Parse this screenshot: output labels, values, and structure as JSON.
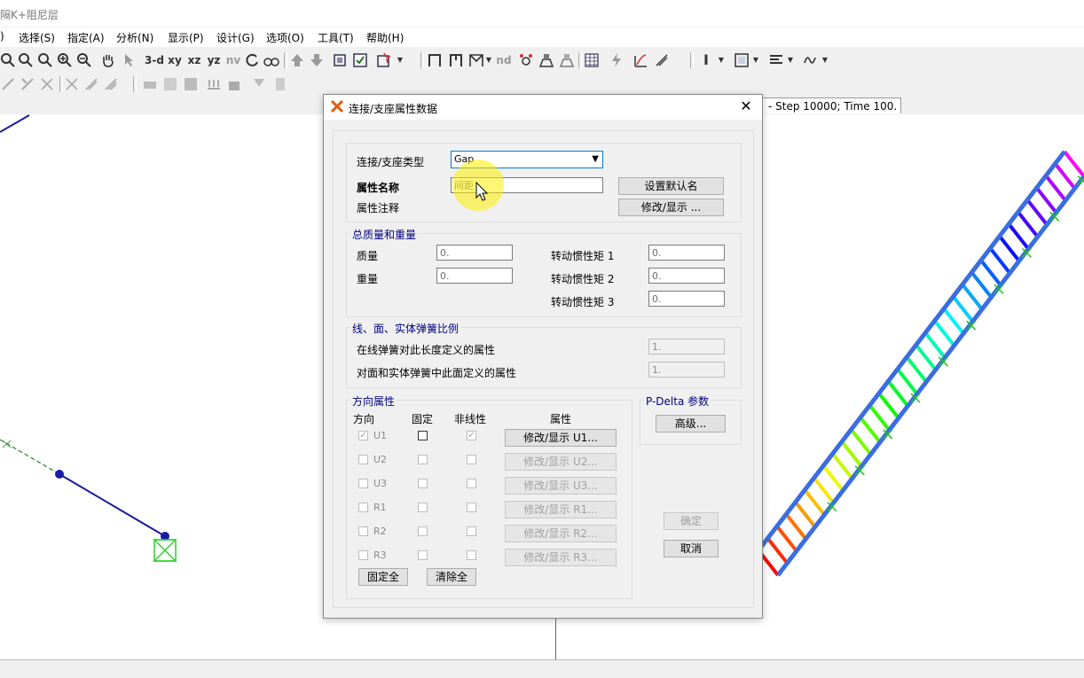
{
  "window": {
    "title": "隔K+阻尼层"
  },
  "menu": [
    "选择(S)",
    "指定(A)",
    "分析(N)",
    "显示(P)",
    "设计(G)",
    "选项(O)",
    "工具(T)",
    "帮助(H)"
  ],
  "toolbar": {
    "view_3d": "3-d",
    "view_xy": "xy",
    "view_xz": "xz",
    "view_yz": "yz",
    "view_nv": "nv",
    "nd": "nd"
  },
  "viewport": {
    "right_tab": "- Step 10000; Time 100."
  },
  "dialog": {
    "title": "连接/支座属性数据",
    "type_label": "连接/支座类型",
    "type_value": "Gap",
    "prop_name_label": "属性名称",
    "prop_name_value": "间距",
    "prop_note_label": "属性注释",
    "set_default_btn": "设置默认名",
    "modify_show_btn": "修改/显示 ...",
    "mass_group": {
      "title": "总质量和重量",
      "mass_label": "质量",
      "mass_value": "0.",
      "weight_label": "重量",
      "weight_value": "0.",
      "rot1_label": "转动惯性矩 1",
      "rot1_value": "0.",
      "rot2_label": "转动惯性矩 2",
      "rot2_value": "0.",
      "rot3_label": "转动惯性矩 3",
      "rot3_value": "0."
    },
    "spring_group": {
      "title": "线、面、实体弹簧比例",
      "line_label": "在线弹簧对此长度定义的属性",
      "line_value": "1.",
      "area_label": "对面和实体弹簧中此面定义的属性",
      "area_value": "1."
    },
    "direction_group": {
      "title": "方向属性",
      "col_direction": "方向",
      "col_fixed": "固定",
      "col_nonlinear": "非线性",
      "col_props": "属性",
      "rows": [
        {
          "dir": "U1",
          "btn": "修改/显示 U1..."
        },
        {
          "dir": "U2",
          "btn": "修改/显示 U2..."
        },
        {
          "dir": "U3",
          "btn": "修改/显示 U3..."
        },
        {
          "dir": "R1",
          "btn": "修改/显示 R1..."
        },
        {
          "dir": "R2",
          "btn": "修改/显示 R2..."
        },
        {
          "dir": "R3",
          "btn": "修改/显示 R3..."
        }
      ],
      "fix_all_btn": "固定全",
      "clear_all_btn": "清除全"
    },
    "pdelta_group": {
      "title": "P-Delta 参数",
      "advanced_btn": "高级..."
    },
    "ok_btn": "确定",
    "cancel_btn": "取消"
  }
}
